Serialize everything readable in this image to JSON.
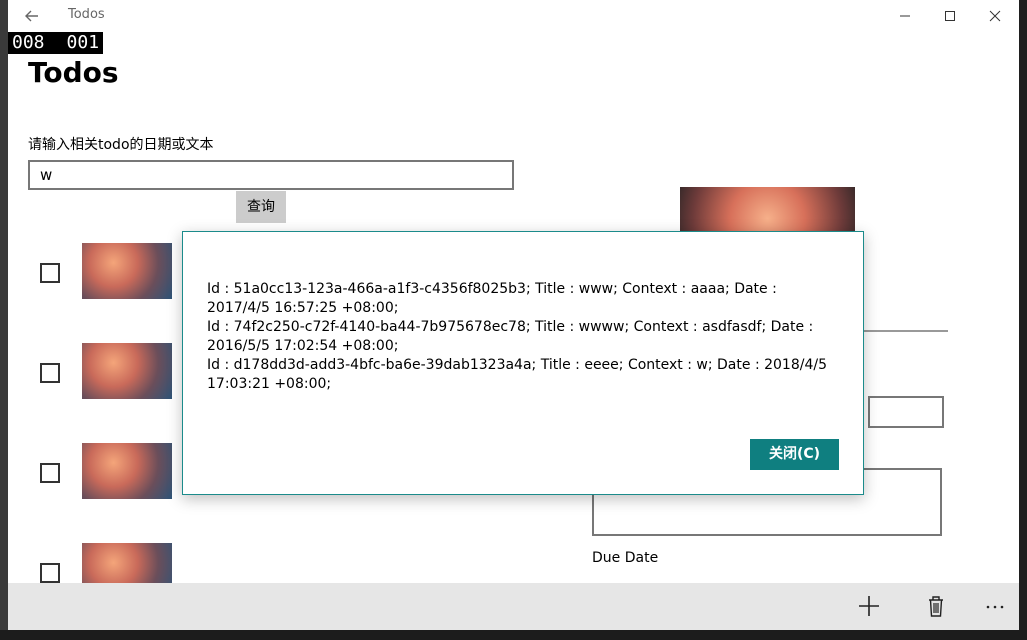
{
  "window": {
    "title": "Todos",
    "frame_counter": [
      "008",
      "001"
    ]
  },
  "page": {
    "title": "Todos",
    "search_label": "请输入相关todo的日期或文本",
    "search_value": "w",
    "query_button": "查询"
  },
  "todos": [
    {
      "checked": false
    },
    {
      "checked": false
    },
    {
      "checked": false
    },
    {
      "checked": false
    }
  ],
  "detail": {
    "due_date_label": "Due Date"
  },
  "dialog": {
    "lines": [
      "Id : 51a0cc13-123a-466a-a1f3-c4356f8025b3;  Title : www;  Context : aaaa;  Date : 2017/4/5 16:57:25 +08:00;",
      "Id : 74f2c250-c72f-4140-ba44-7b975678ec78;  Title : wwww;  Context : asdfasdf;  Date : 2016/5/5 17:02:54 +08:00;",
      "Id : d178dd3d-add3-4bfc-ba6e-39dab1323a4a;  Title : eeee;  Context : w;  Date : 2018/4/5 17:03:21 +08:00;"
    ],
    "close_button": "关闭(C)",
    "accent_color": "#0f7f80"
  },
  "app_bar": {
    "icons": [
      "add-icon",
      "delete-icon",
      "more-icon"
    ]
  }
}
